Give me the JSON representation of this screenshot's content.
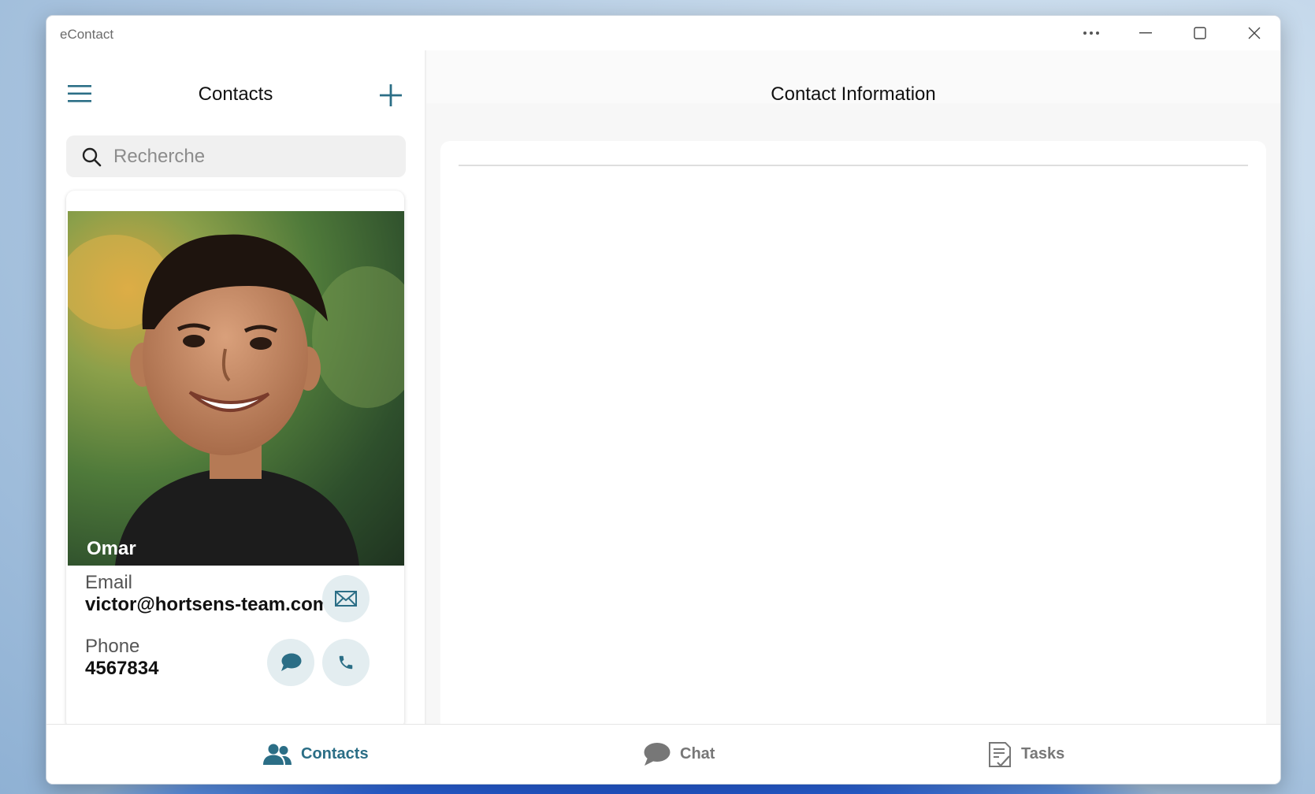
{
  "window": {
    "title": "eContact"
  },
  "left": {
    "title": "Contacts",
    "search": {
      "placeholder": "Recherche",
      "value": ""
    }
  },
  "contact": {
    "name": "Omar",
    "email_label": "Email",
    "email": "victor@hortsens-team.com",
    "phone_label": "Phone",
    "phone": "4567834"
  },
  "right": {
    "title": "Contact Information"
  },
  "nav": {
    "items": [
      {
        "label": "Contacts",
        "icon": "people-icon",
        "active": true
      },
      {
        "label": "Chat",
        "icon": "chat-bubble-icon",
        "active": false
      },
      {
        "label": "Tasks",
        "icon": "tasks-icon",
        "active": false
      }
    ]
  },
  "colors": {
    "accent": "#2b6e86",
    "button_bg": "#e3edf0",
    "inactive": "#777777"
  }
}
